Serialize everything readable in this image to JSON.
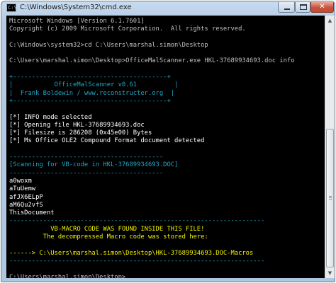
{
  "window": {
    "title": "C:\\Windows\\System32\\cmd.exe",
    "icon_label": "C:\\",
    "buttons": {
      "minimize": "minimize",
      "maximize": "maximize",
      "close": "✕"
    }
  },
  "console": {
    "lines": [
      {
        "text": "Microsoft Windows [Version 6.1.7601]",
        "color": "w"
      },
      {
        "text": "Copyright (c) 2009 Microsoft Corporation.  All rights reserved.",
        "color": "w"
      },
      {
        "text": "",
        "color": "w"
      },
      {
        "text": "C:\\Windows\\system32>cd C:\\Users\\marshal.simon\\Desktop",
        "color": "w"
      },
      {
        "text": "",
        "color": "w"
      },
      {
        "text": "C:\\Users\\marshal.simon\\Desktop>OfficeMalScanner.exe HKL-37689934693.doc info",
        "color": "w"
      },
      {
        "text": "",
        "color": "w"
      },
      {
        "text": "+-----------------------------------------+",
        "color": "c"
      },
      {
        "text": "|           OfficeMalScanner v0.61          |",
        "color": "c"
      },
      {
        "text": "|  Frank Boldewin / www.reconstructer.org  |",
        "color": "c"
      },
      {
        "text": "+-----------------------------------------+",
        "color": "c"
      },
      {
        "text": "",
        "color": "w"
      },
      {
        "text": "[*] INFO mode selected",
        "color": "b"
      },
      {
        "text": "[*] Opening file HKL-37689934693.doc",
        "color": "b"
      },
      {
        "text": "[*] Filesize is 286208 (0x45e00) Bytes",
        "color": "b"
      },
      {
        "text": "[*] Ms Office OLE2 Compound Format document detected",
        "color": "b"
      },
      {
        "text": "",
        "color": "w"
      },
      {
        "text": "-----------------------------------------",
        "color": "c"
      },
      {
        "text": "[Scanning for VB-code in HKL-37689934693.DOC]",
        "color": "c"
      },
      {
        "text": "-----------------------------------------",
        "color": "c"
      },
      {
        "text": "a0woxm",
        "color": "b"
      },
      {
        "text": "aTuUemw",
        "color": "b"
      },
      {
        "text": "afJX6ELpP",
        "color": "b"
      },
      {
        "text": "aM6Qu2vfS",
        "color": "b"
      },
      {
        "text": "ThisDocument",
        "color": "b"
      },
      {
        "text": "--------------------------------------------------------------------",
        "color": "c"
      },
      {
        "text": "           VB-MACRO CODE WAS FOUND INSIDE THIS FILE!",
        "color": "y"
      },
      {
        "text": "         The decompressed Macro code was stored here:",
        "color": "y"
      },
      {
        "text": "",
        "color": "w"
      },
      {
        "text": "------> C:\\Users\\marshal.simon\\Desktop\\HKL-37689934693.DOC-Macros",
        "color": "y"
      },
      {
        "text": "--------------------------------------------------------------------",
        "color": "c"
      },
      {
        "text": "",
        "color": "w"
      },
      {
        "text": "C:\\Users\\marshal.simon\\Desktop>",
        "color": "w"
      }
    ]
  },
  "scrollbar": {
    "up_arrow": "▲",
    "down_arrow": "▼"
  }
}
